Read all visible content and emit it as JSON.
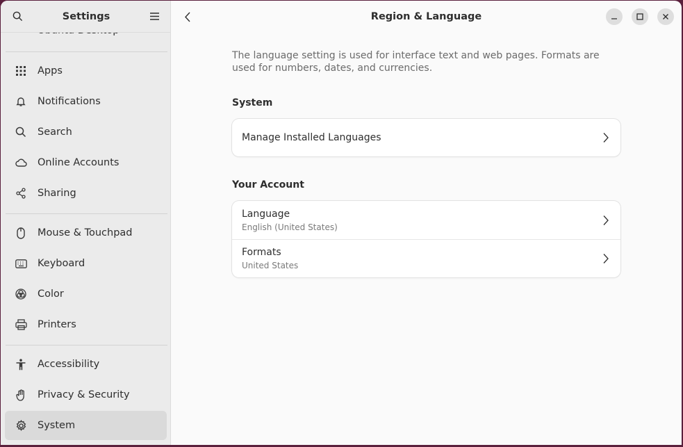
{
  "sidebar": {
    "title": "Settings",
    "partial_item": "Ubuntu Desktop",
    "items": [
      {
        "label": "Apps",
        "icon": "apps-grid-icon"
      },
      {
        "label": "Notifications",
        "icon": "bell-icon"
      },
      {
        "label": "Search",
        "icon": "search-icon"
      },
      {
        "label": "Online Accounts",
        "icon": "cloud-icon"
      },
      {
        "label": "Sharing",
        "icon": "share-icon"
      },
      {
        "label": "Mouse & Touchpad",
        "icon": "mouse-icon"
      },
      {
        "label": "Keyboard",
        "icon": "keyboard-icon"
      },
      {
        "label": "Color",
        "icon": "color-icon"
      },
      {
        "label": "Printers",
        "icon": "printer-icon"
      },
      {
        "label": "Accessibility",
        "icon": "accessibility-icon"
      },
      {
        "label": "Privacy & Security",
        "icon": "hand-icon"
      },
      {
        "label": "System",
        "icon": "gear-icon"
      }
    ],
    "selected": "System"
  },
  "main": {
    "title": "Region & Language",
    "description": "The language setting is used for interface text and web pages. Formats are used for numbers, dates, and currencies.",
    "system_section": {
      "title": "System",
      "rows": [
        {
          "title": "Manage Installed Languages"
        }
      ]
    },
    "account_section": {
      "title": "Your Account",
      "rows": [
        {
          "title": "Language",
          "subtitle": "English (United States)"
        },
        {
          "title": "Formats",
          "subtitle": "United States"
        }
      ]
    }
  },
  "colors": {
    "desktop_bg": "#5a1f3c",
    "sidebar_bg": "#ebebeb",
    "content_bg": "#fafafa",
    "selected_bg": "#dadada"
  }
}
